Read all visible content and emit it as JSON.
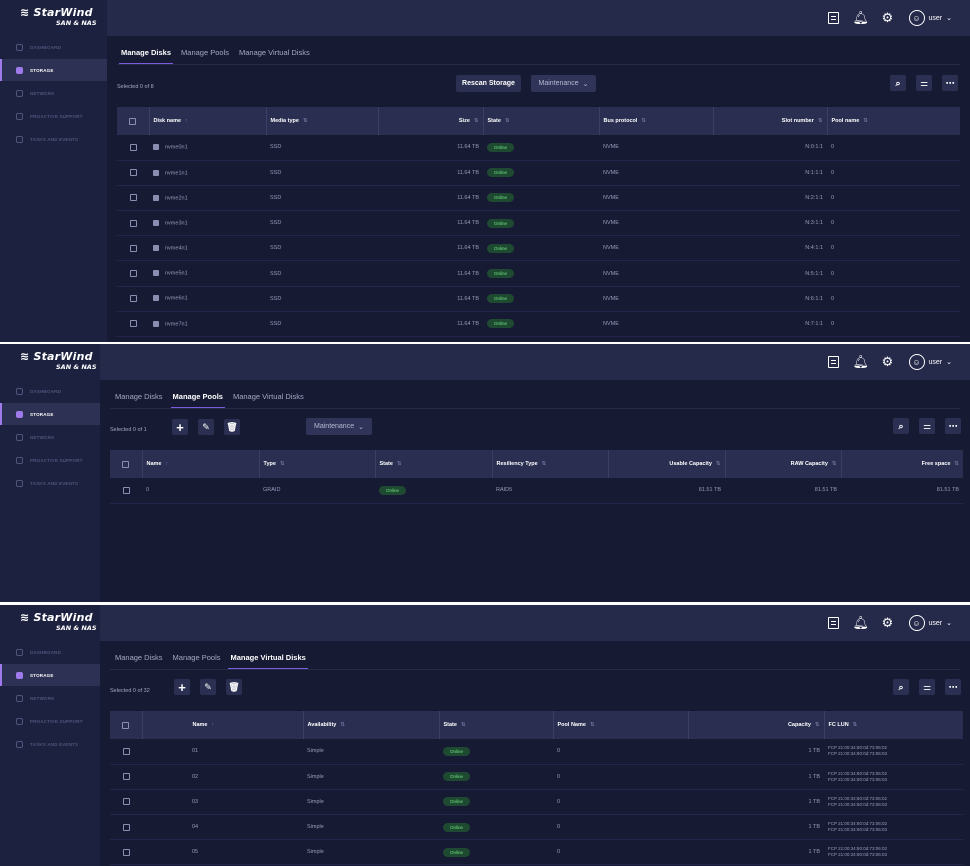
{
  "app": {
    "logo_main": "StarWind",
    "logo_sub": "SAN & NAS",
    "nav": [
      "DASHBOARD",
      "STORAGE",
      "NETWORK",
      "PROACTIVE SUPPORT",
      "TASKS AND EVENTS"
    ],
    "user": "user",
    "icons": {
      "table": "table-icon",
      "bell": "bell-icon",
      "gear": "gear-icon",
      "avatar": "avatar-icon"
    }
  },
  "tabs": [
    "Manage Disks",
    "Manage Pools",
    "Manage Virtual Disks"
  ],
  "colors": {
    "bg": "#161a33",
    "sidebar": "#1d2140",
    "accent": "#9f7aea",
    "online_bg": "#1f4a32",
    "online_text": "#6ee07c"
  },
  "disks": {
    "selected": "Selected 0 of 8",
    "rescan": "Rescan Storage",
    "maintenance": "Maintenance",
    "columns": [
      "Disk name",
      "Media type",
      "Size",
      "State",
      "Bus protocol",
      "Slot number",
      "Pool name"
    ],
    "rows": [
      {
        "name": "nvme0n1",
        "media": "SSD",
        "size": "11.64 TB",
        "state": "Online",
        "bus": "NVME",
        "slot": "N:0:1:1",
        "pool": "0"
      },
      {
        "name": "nvme1n1",
        "media": "SSD",
        "size": "11.64 TB",
        "state": "Online",
        "bus": "NVME",
        "slot": "N:1:1:1",
        "pool": "0"
      },
      {
        "name": "nvme2n1",
        "media": "SSD",
        "size": "11.64 TB",
        "state": "Online",
        "bus": "NVME",
        "slot": "N:2:1:1",
        "pool": "0"
      },
      {
        "name": "nvme3n1",
        "media": "SSD",
        "size": "11.64 TB",
        "state": "Online",
        "bus": "NVME",
        "slot": "N:3:1:1",
        "pool": "0"
      },
      {
        "name": "nvme4n1",
        "media": "SSD",
        "size": "11.64 TB",
        "state": "Online",
        "bus": "NVME",
        "slot": "N:4:1:1",
        "pool": "0"
      },
      {
        "name": "nvme5n1",
        "media": "SSD",
        "size": "11.64 TB",
        "state": "Online",
        "bus": "NVME",
        "slot": "N:5:1:1",
        "pool": "0"
      },
      {
        "name": "nvme6n1",
        "media": "SSD",
        "size": "11.64 TB",
        "state": "Online",
        "bus": "NVME",
        "slot": "N:6:1:1",
        "pool": "0"
      },
      {
        "name": "nvme7n1",
        "media": "SSD",
        "size": "11.64 TB",
        "state": "Online",
        "bus": "NVME",
        "slot": "N:7:1:1",
        "pool": "0"
      }
    ]
  },
  "pools": {
    "selected": "Selected 0 of 1",
    "maintenance": "Maintenance",
    "columns": [
      "Name",
      "Type",
      "State",
      "Resiliency Type",
      "Usable Capacity",
      "RAW Capacity",
      "Free space"
    ],
    "rows": [
      {
        "name": "0",
        "type": "GRAID",
        "state": "Online",
        "resiliency": "RAID5",
        "usable": "81.51 TB",
        "raw": "81.51 TB",
        "free": "81.51 TB"
      }
    ]
  },
  "vdisks": {
    "selected": "Selected 0 of 32",
    "columns": [
      "Name",
      "Availability",
      "State",
      "Pool Name",
      "Capacity",
      "FC LUN"
    ],
    "rows": [
      {
        "name": "01",
        "availability": "Simple",
        "state": "Online",
        "pool": "0",
        "capacity": "1 TB",
        "lun1": "FCP 21:00:34:80:0d:73:06:02",
        "lun2": "FCP 21:00:34:80:0d:73:06:03"
      },
      {
        "name": "02",
        "availability": "Simple",
        "state": "Online",
        "pool": "0",
        "capacity": "1 TB",
        "lun1": "FCP 21:00:34:80:0d:73:06:02",
        "lun2": "FCP 21:00:34:80:0d:73:06:03"
      },
      {
        "name": "03",
        "availability": "Simple",
        "state": "Online",
        "pool": "0",
        "capacity": "1 TB",
        "lun1": "FCP 21:00:34:80:0d:73:06:02",
        "lun2": "FCP 21:00:34:80:0d:73:06:03"
      },
      {
        "name": "04",
        "availability": "Simple",
        "state": "Online",
        "pool": "0",
        "capacity": "1 TB",
        "lun1": "FCP 21:00:34:80:0d:73:06:02",
        "lun2": "FCP 21:00:34:80:0d:73:06:03"
      },
      {
        "name": "05",
        "availability": "Simple",
        "state": "Online",
        "pool": "0",
        "capacity": "1 TB",
        "lun1": "FCP 21:00:34:80:0d:73:06:02",
        "lun2": "FCP 21:00:34:80:0d:73:06:03"
      }
    ]
  }
}
